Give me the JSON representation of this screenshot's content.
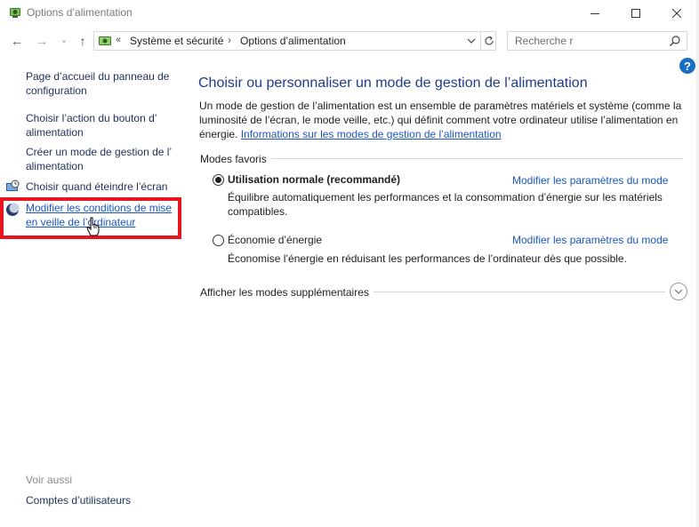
{
  "window": {
    "title": "Options d’alimentation"
  },
  "nav": {
    "back": "←",
    "forward": "→",
    "recent": "⌄",
    "up": "↑",
    "address_chevrons": "«",
    "crumbs": [
      "Système et sécurité",
      "Options d’alimentation"
    ],
    "separator": "›"
  },
  "search": {
    "placeholder": "Recherche r"
  },
  "help": {
    "label": "?"
  },
  "sidebar": {
    "items": [
      {
        "label_lines": [
          "Page d’accueil du panneau de",
          "configuration"
        ]
      },
      {
        "label_lines": [
          "Choisir l’action du bouton d’",
          "alimentation"
        ]
      },
      {
        "label_lines": [
          "Créer un mode de gestion de l’",
          "alimentation"
        ]
      },
      {
        "label_lines": [
          "Choisir quand éteindre l’écran"
        ]
      },
      {
        "label_lines": [
          "Modifier les conditions de mise",
          "en veille de l’ordinateur"
        ]
      }
    ],
    "see_also": "Voir aussi",
    "users": "Comptes d’utilisateurs"
  },
  "main": {
    "title": "Choisir ou personnaliser un mode de gestion de l’alimentation",
    "description": "Un mode de gestion de l’alimentation est un ensemble de paramètres matériels et système (comme la luminosité de l’écran, le mode veille, etc.) qui définit comment votre ordinateur utilise l’alimentation en énergie.",
    "info_link": "Informations sur les modes de gestion de l’alimentation",
    "group_label": "Modes favoris",
    "plans": [
      {
        "name": "Utilisation normale (recommandé)",
        "selected": true,
        "description": "Équilibre automatiquement les performances et la consommation d’énergie sur les matériels compatibles.",
        "link": "Modifier les paramètres du mode"
      },
      {
        "name": "Économie d’énergie",
        "selected": false,
        "description": "Économise l’énergie en réduisant les performances de l’ordinateur dès que possible.",
        "link": "Modifier les paramètres du mode"
      }
    ],
    "more_label": "Afficher les modes supplémentaires"
  },
  "colors": {
    "link": "#1a55c4",
    "title": "#1d3d8a",
    "highlight": "#e8141e"
  }
}
